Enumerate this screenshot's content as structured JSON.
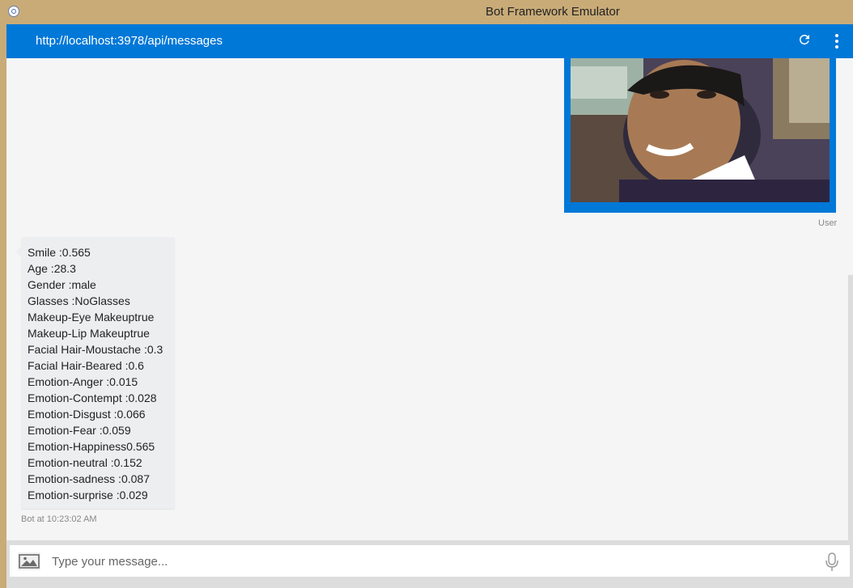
{
  "window": {
    "title": "Bot Framework Emulator"
  },
  "toolbar": {
    "url": "http://localhost:3978/api/messages"
  },
  "chat": {
    "user_message": {
      "sender_label": "User"
    },
    "bot_message": {
      "lines": [
        "Smile :0.565",
        "Age :28.3",
        "Gender :male",
        "Glasses :NoGlasses",
        "Makeup-Eye Makeuptrue",
        "Makeup-Lip Makeuptrue",
        "Facial Hair-Moustache :0.3",
        "Facial Hair-Beared :0.6",
        "Emotion-Anger :0.015",
        "Emotion-Contempt :0.028",
        "Emotion-Disgust :0.066",
        "Emotion-Fear :0.059",
        "Emotion-Happiness0.565",
        "Emotion-neutral :0.152",
        "Emotion-sadness :0.087",
        "Emotion-surprise :0.029"
      ],
      "meta": "Bot at 10:23:02 AM"
    }
  },
  "composer": {
    "placeholder": "Type your message..."
  },
  "icons": {
    "app": "emulator-icon",
    "refresh": "refresh-icon",
    "menu": "more-vertical-icon",
    "image": "image-icon",
    "mic": "microphone-icon"
  },
  "colors": {
    "accent": "#0078d7",
    "window_chrome": "#c9ab78",
    "chat_bg": "#f5f5f5"
  }
}
